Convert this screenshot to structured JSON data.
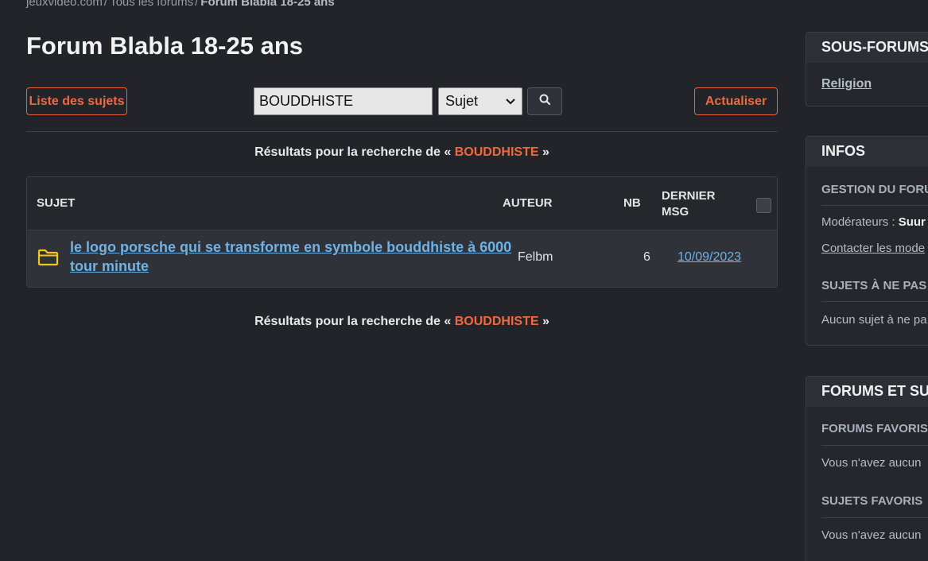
{
  "breadcrumb": {
    "items": [
      "jeuxvideo.com",
      "Tous les forums"
    ],
    "separator": "/",
    "current": "Forum Blabla 18-25 ans"
  },
  "page_title": "Forum Blabla 18-25 ans",
  "toolbar": {
    "list_label": "Liste des sujets",
    "refresh_label": "Actualiser",
    "search_value": "BOUDDHISTE",
    "search_type": "Sujet",
    "search_icon": "search-icon"
  },
  "results": {
    "prefix": "Résultats pour la recherche de «",
    "term": "BOUDDHISTE",
    "suffix": "»"
  },
  "table": {
    "headers": {
      "subject": "SUJET",
      "author": "AUTEUR",
      "nb": "NB",
      "last": "DERNIER MSG"
    },
    "rows": [
      {
        "icon": "folder-icon",
        "subject": "le logo porsche qui se transforme en symbole bouddhiste à 6000 tour minute",
        "author": "Felbm",
        "nb": "6",
        "last": "10/09/2023"
      }
    ]
  },
  "sidebar": {
    "subforums": {
      "title": "SOUS-FORUMS",
      "items": [
        "Religion"
      ]
    },
    "infos": {
      "title": "INFOS",
      "management_heading": "GESTION DU FORU",
      "moderators_label": "Modérateurs :",
      "moderators_value": "Suur",
      "contact": "Contacter les mode",
      "no_miss_heading": "SUJETS À NE PAS",
      "no_miss_text": "Aucun sujet à ne pa"
    },
    "favorites": {
      "title": "FORUMS ET SUJ",
      "forums_heading": "FORUMS FAVORIS",
      "forums_text": "Vous n'avez aucun",
      "topics_heading": "SUJETS FAVORIS",
      "topics_text": "Vous n'avez aucun"
    }
  },
  "colors": {
    "accent": "#f0693e",
    "link": "#6fb3e6",
    "background": "#222429",
    "folder": "#f5c518"
  }
}
